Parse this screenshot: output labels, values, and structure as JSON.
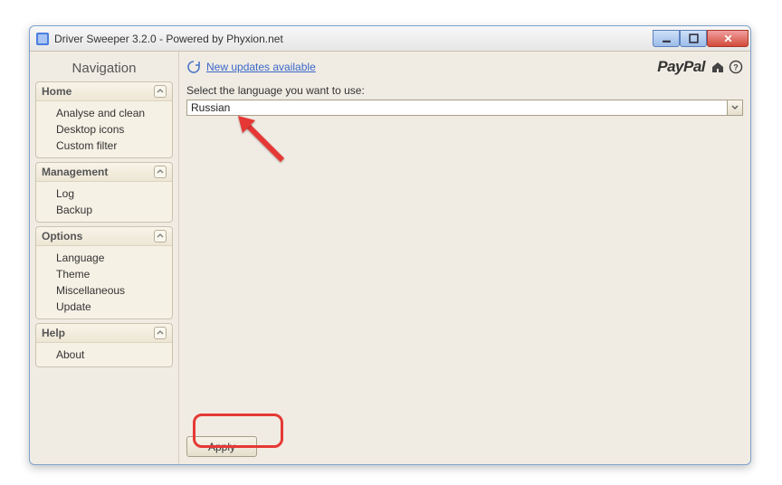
{
  "window": {
    "title": "Driver Sweeper 3.2.0 - Powered by Phyxion.net"
  },
  "sidebar": {
    "title": "Navigation",
    "groups": [
      {
        "title": "Home",
        "items": [
          "Analyse and clean",
          "Desktop icons",
          "Custom filter"
        ]
      },
      {
        "title": "Management",
        "items": [
          "Log",
          "Backup"
        ]
      },
      {
        "title": "Options",
        "items": [
          "Language",
          "Theme",
          "Miscellaneous",
          "Update"
        ]
      },
      {
        "title": "Help",
        "items": [
          "About"
        ]
      }
    ]
  },
  "main": {
    "updates_link": "New updates available",
    "paypal_label": "PayPal",
    "language_label": "Select the language you want to use:",
    "language_value": "Russian",
    "apply_label": "Apply"
  }
}
